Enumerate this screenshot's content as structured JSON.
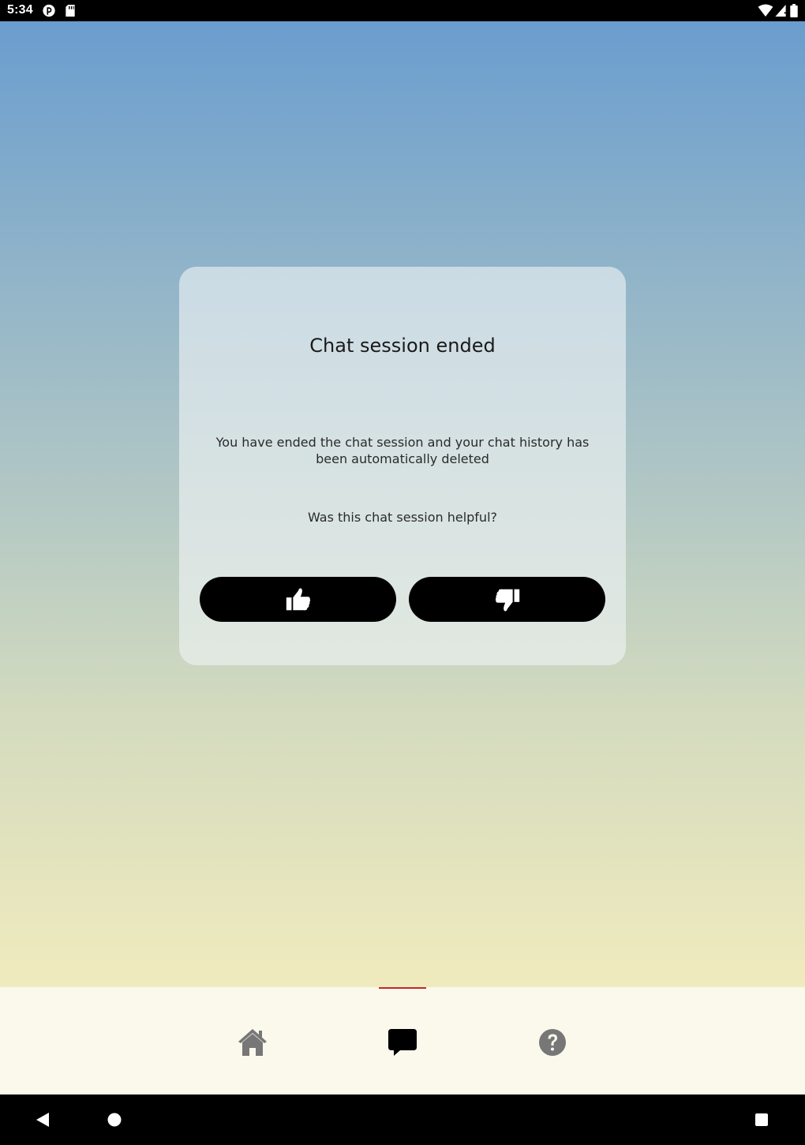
{
  "status_bar": {
    "time": "5:34",
    "icons": [
      "app-notification-icon",
      "sd-card-icon",
      "wifi-icon",
      "cell-signal-icon",
      "battery-icon"
    ]
  },
  "dialog": {
    "title": "Chat session ended",
    "message": "You have ended the chat session and your chat history has been automatically deleted",
    "question": "Was this chat session helpful?",
    "buttons": [
      {
        "name": "thumbs-up-button",
        "icon": "thumbs-up-icon"
      },
      {
        "name": "thumbs-down-button",
        "icon": "thumbs-down-icon"
      }
    ]
  },
  "bottom_nav": {
    "items": [
      {
        "name": "home",
        "icon": "home-icon",
        "active": false
      },
      {
        "name": "chat",
        "icon": "chat-bubble-icon",
        "active": true
      },
      {
        "name": "help",
        "icon": "help-icon",
        "active": false
      }
    ],
    "indicator_color": "#c0282d"
  },
  "system_nav": {
    "buttons": [
      "back-icon",
      "home-circle-icon",
      "recents-icon"
    ]
  },
  "colors": {
    "gradient_top": "#6a9dcf",
    "gradient_bottom": "#f0ebbe",
    "button_bg": "#000000",
    "nav_bg": "#fbf9ec",
    "icon_gray": "#777777"
  }
}
